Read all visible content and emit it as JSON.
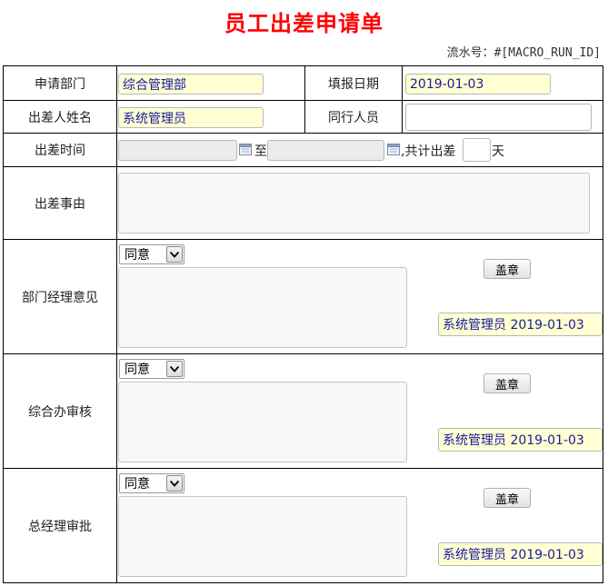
{
  "form": {
    "title": "员工出差申请单",
    "serial_label": "流水号：#[MACRO_RUN_ID]"
  },
  "rows": {
    "department": {
      "label": "申请部门",
      "value": "综合管理部"
    },
    "fill_date": {
      "label": "填报日期",
      "value": "2019-01-03"
    },
    "traveler": {
      "label": "出差人姓名",
      "value": "系统管理员"
    },
    "companions": {
      "label": "同行人员",
      "value": ""
    },
    "trip_time": {
      "label": "出差时间",
      "start": "",
      "to_text": "至",
      "end": "",
      "total_text": ",共计出差",
      "days": "",
      "days_unit": "天"
    },
    "reason": {
      "label": "出差事由",
      "value": ""
    }
  },
  "approvals": [
    {
      "label": "部门经理意见",
      "opinion": "同意",
      "comment": "",
      "stamp_label": "盖章",
      "signature": "系统管理员 2019-01-03"
    },
    {
      "label": "综合办审核",
      "opinion": "同意",
      "comment": "",
      "stamp_label": "盖章",
      "signature": "系统管理员 2019-01-03"
    },
    {
      "label": "总经理审批",
      "opinion": "同意",
      "comment": "",
      "stamp_label": "盖章",
      "signature": "系统管理员 2019-01-03"
    }
  ],
  "icons": {
    "calendar": "calendar-icon",
    "dropdown": "chevron-down-icon"
  },
  "colors": {
    "title": "#ff0000",
    "autofill_bg": "#ffffd2",
    "autofill_text": "#1a1aa0",
    "readonly_bg": "#ebebeb"
  }
}
